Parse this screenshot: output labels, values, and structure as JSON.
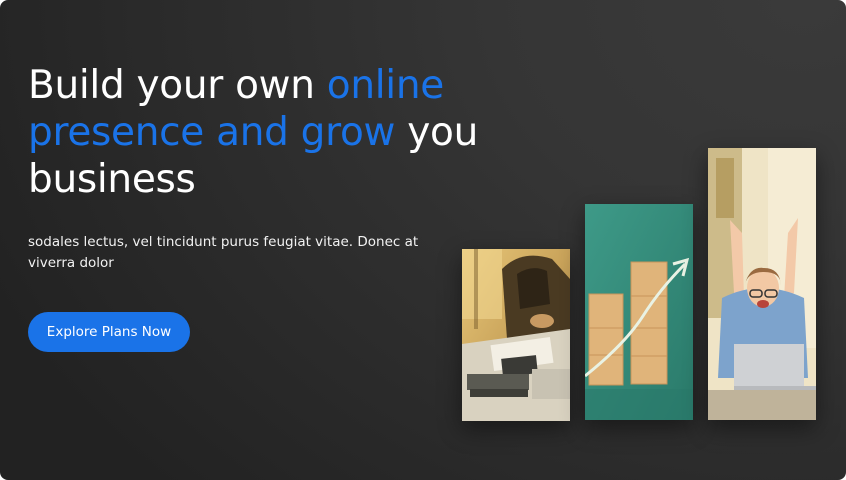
{
  "hero": {
    "headline_lead": "Build your own ",
    "headline_accent": "online presence and grow",
    "headline_tail": " you business",
    "subtext": "sodales lectus, vel tincidunt purus feugiat vitae. Donec at viverra dolor",
    "cta_label": "Explore Plans Now"
  },
  "colors": {
    "accent": "#1a73e8",
    "background": "#2d2d2d",
    "text": "#ffffff"
  },
  "images": [
    {
      "subject": "business-meeting-photo"
    },
    {
      "subject": "growth-blocks-photo"
    },
    {
      "subject": "celebrating-woman-photo"
    }
  ]
}
